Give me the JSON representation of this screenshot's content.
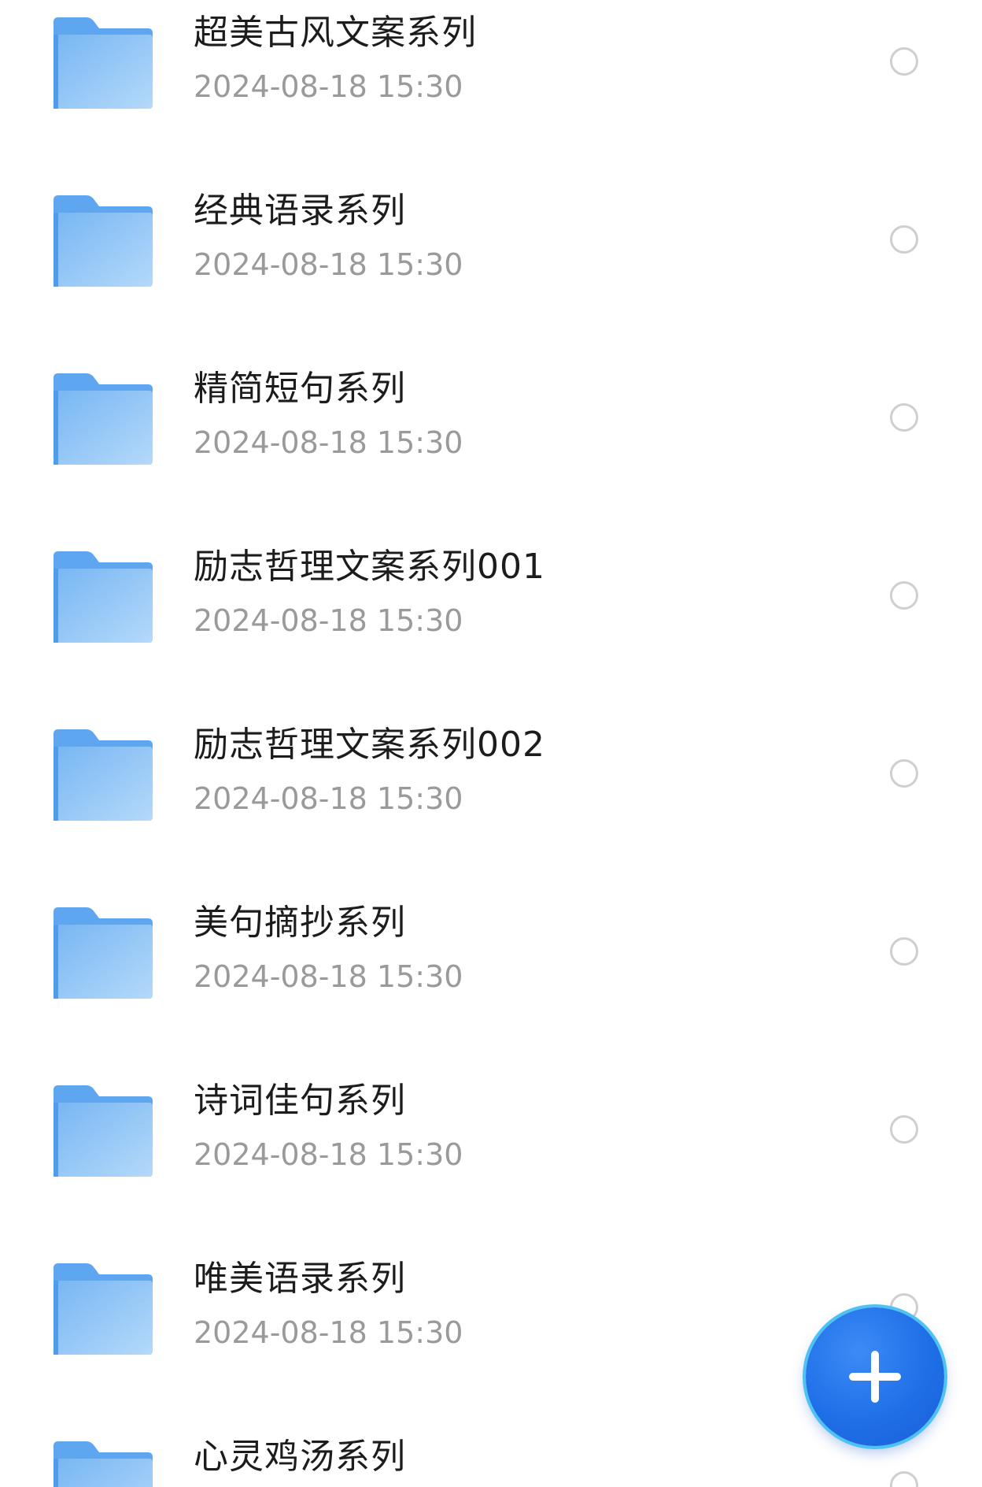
{
  "folders": [
    {
      "name": "超美古风文案系列",
      "date": "2024-08-18 15:30"
    },
    {
      "name": "经典语录系列",
      "date": "2024-08-18 15:30"
    },
    {
      "name": "精简短句系列",
      "date": "2024-08-18 15:30"
    },
    {
      "name": "励志哲理文案系列001",
      "date": "2024-08-18 15:30"
    },
    {
      "name": "励志哲理文案系列002",
      "date": "2024-08-18 15:30"
    },
    {
      "name": "美句摘抄系列",
      "date": "2024-08-18 15:30"
    },
    {
      "name": "诗词佳句系列",
      "date": "2024-08-18 15:30"
    },
    {
      "name": "唯美语录系列",
      "date": "2024-08-18 15:30"
    },
    {
      "name": "心灵鸡汤系列"
    }
  ],
  "icons": {
    "folder": "folder-icon",
    "select": "radio-circle-icon",
    "add": "plus-icon"
  },
  "colors": {
    "title": "#1c1c1c",
    "date": "#9a9a9a",
    "folder": "#8ec4f6",
    "fab": "#1f6fe8",
    "radio": "#cfcfcf"
  }
}
